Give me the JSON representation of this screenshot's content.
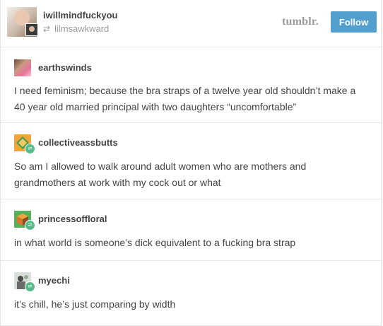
{
  "header": {
    "username": "iwillmindfuckyou",
    "reblogged_from": "lilmsawkward",
    "platform_logo": "tumblr.",
    "follow_label": "Follow"
  },
  "posts": [
    {
      "username": "earthswinds",
      "text": "I need feminism; because the bra straps of a twelve year old shouldn’t make a 40 year old married principal with two daughters “uncomfortable”"
    },
    {
      "username": "collectiveassbutts",
      "text": "So am I allowed to walk around adult women who are mothers and grandmothers at work with my cock out or what"
    },
    {
      "username": "princessoffloral",
      "text": "in what world is someone’s dick equivalent to a fucking bra strap"
    },
    {
      "username": "myechi",
      "text": "it’s chill, he’s just comparing by width"
    }
  ],
  "colors": {
    "accent": "#529ecc",
    "reblog_badge": "#56bc8a",
    "divider": "#e6e6e6"
  },
  "icons": {
    "reblog": "reblog-icon",
    "badge": "reblog-badge-icon"
  }
}
